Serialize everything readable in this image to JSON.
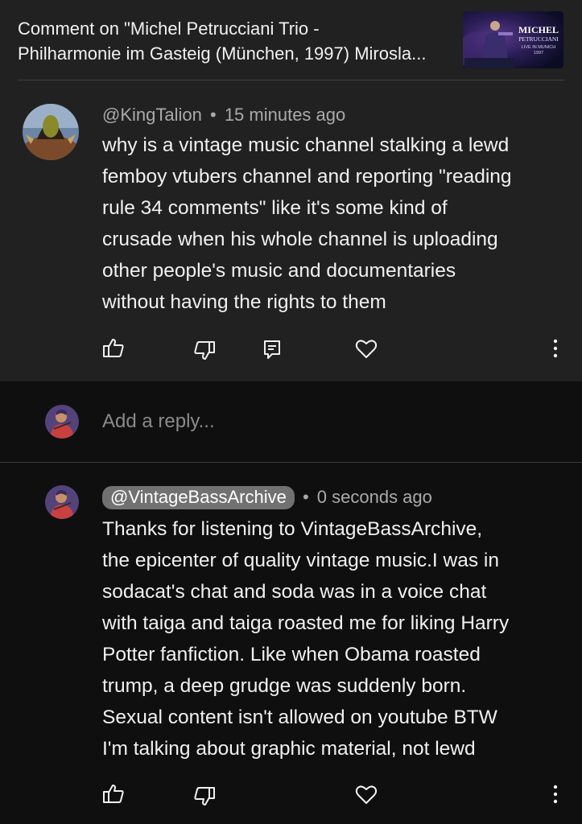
{
  "header": {
    "title": "Comment on \"Michel Petrucciani Trio -\nPhilharmonie im Gasteig (München, 1997) Mirosla...",
    "thumbnail": {
      "line1": "MICHEL",
      "line2": "PETRUCCIANI",
      "line3": "LIVE IN MUNICH",
      "line4": "1997"
    }
  },
  "comment": {
    "author": "@KingTalion",
    "separator": "•",
    "time": "15 minutes ago",
    "text": "why is a vintage music channel stalking a lewd\nfemboy vtubers channel and reporting \"reading\nrule 34 comments\" like it's some kind of\ncrusade when his whole channel is uploading\nother people's music and documentaries\nwithout having the rights to them",
    "actions": [
      "like-icon",
      "dislike-icon",
      "reply-icon",
      "heart-icon",
      "more-icon"
    ]
  },
  "reply_box": {
    "placeholder": "Add a reply..."
  },
  "reply": {
    "author": "@VintageBassArchive",
    "separator": "•",
    "time": "0 seconds ago",
    "text": "Thanks for listening to VintageBassArchive,\nthe epicenter of quality vintage music.I was in\nsodacat's chat and soda was in a voice chat\nwith taiga and taiga roasted me for liking Harry\nPotter fanfiction. Like when Obama roasted\ntrump, a deep grudge was suddenly born.\nSexual content isn't allowed on youtube BTW\nI'm talking about graphic material, not lewd",
    "actions": [
      "like-icon",
      "dislike-icon",
      "heart-icon",
      "more-icon"
    ]
  },
  "colors": {
    "background": "#0f0f0f",
    "card": "#212121",
    "text": "#f1f1f1",
    "muted": "#aaaaaa",
    "chip": "#717171"
  }
}
